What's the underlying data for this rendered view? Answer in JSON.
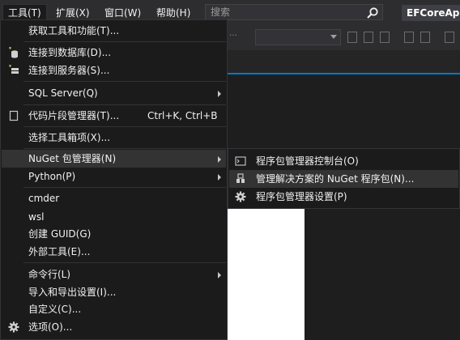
{
  "menubar": {
    "items": [
      {
        "label": "工具(T)"
      },
      {
        "label": "扩展(X)"
      },
      {
        "label": "窗口(W)"
      },
      {
        "label": "帮助(H)"
      }
    ],
    "search_placeholder": "搜索",
    "app_title": "EFCoreApp"
  },
  "tools_menu": {
    "items": [
      {
        "label": "获取工具和功能(T)..."
      },
      {
        "label": "连接到数据库(D)..."
      },
      {
        "label": "连接到服务器(S)..."
      },
      {
        "label": "SQL Server(Q)"
      },
      {
        "label": "代码片段管理器(T)...",
        "shortcut": "Ctrl+K, Ctrl+B"
      },
      {
        "label": "选择工具箱项(X)..."
      },
      {
        "label": "NuGet 包管理器(N)"
      },
      {
        "label": "Python(P)"
      },
      {
        "label": "cmder"
      },
      {
        "label": "wsl"
      },
      {
        "label": "创建 GUID(G)"
      },
      {
        "label": "外部工具(E)..."
      },
      {
        "label": "命令行(L)"
      },
      {
        "label": "导入和导出设置(I)..."
      },
      {
        "label": "自定义(C)..."
      },
      {
        "label": "选项(O)..."
      }
    ]
  },
  "nuget_submenu": {
    "items": [
      {
        "label": "程序包管理器控制台(O)"
      },
      {
        "label": "管理解决方案的 NuGet 程序包(N)..."
      },
      {
        "label": "程序包管理器设置(P)"
      }
    ]
  },
  "colors": {
    "accent": "#007acc",
    "menu_bg": "#1b1b1c",
    "highlight": "#333334"
  }
}
